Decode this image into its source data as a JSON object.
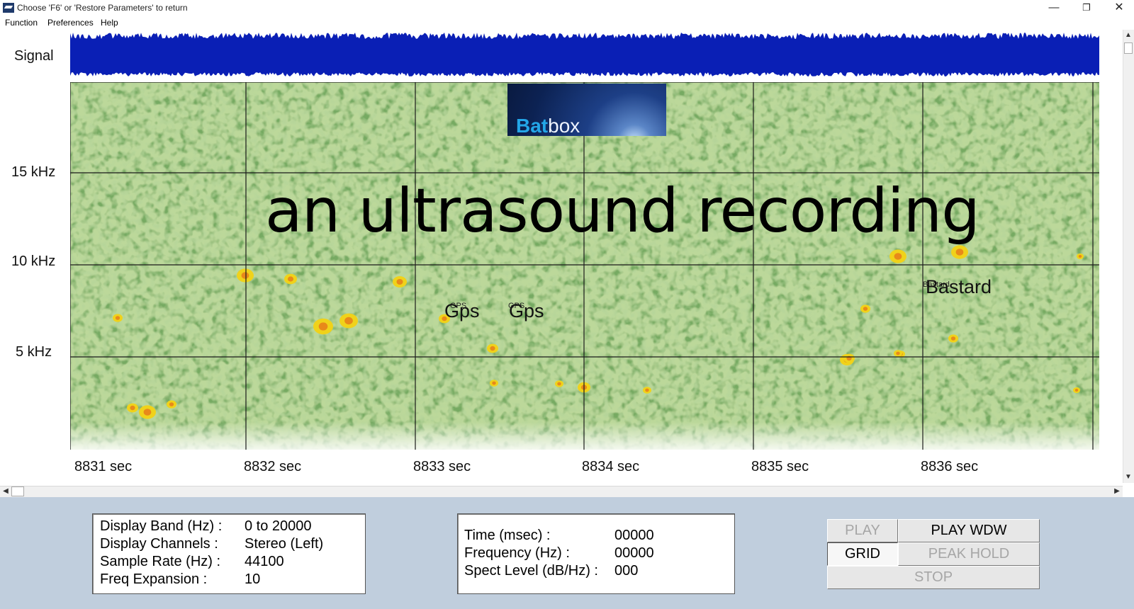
{
  "window": {
    "title": "Choose 'F6' or 'Restore Parameters' to return",
    "min_glyph": "—",
    "max_glyph": "❐",
    "close_glyph": "✕"
  },
  "menu": [
    "Function",
    "Preferences",
    "Help"
  ],
  "display": {
    "signal_label": "Signal",
    "freq_labels": [
      "15 kHz",
      "10 kHz",
      "5 kHz"
    ],
    "time_labels": [
      "8831 sec",
      "8832 sec",
      "8833 sec",
      "8834 sec",
      "8835 sec",
      "8836 sec"
    ],
    "logo": {
      "bold": "Bat",
      "rest": "box"
    },
    "overlay_title": "an ultrasound recording",
    "annotations": [
      {
        "small": "GPS",
        "large": "Gps"
      },
      {
        "small": "GPS",
        "large": "Gps"
      },
      {
        "small": "Bastard",
        "large": "Bastard"
      }
    ],
    "colors": {
      "waveform": "#0a1fb5",
      "spectrogram_background": "#bcd89a",
      "grid": "#1a1a1a"
    }
  },
  "scrollbars": {
    "up": "▲",
    "down": "▼",
    "left": "◀",
    "right": "▶"
  },
  "info_left": [
    {
      "label": "Display Band (Hz) :",
      "value": "0 to 20000"
    },
    {
      "label": "Display Channels  :",
      "value": "Stereo (Left)"
    },
    {
      "label": "Sample Rate (Hz) :",
      "value": "44100"
    },
    {
      "label": "Freq Expansion    :",
      "value": "10"
    }
  ],
  "info_right": [
    {
      "label": "Time (msec) :",
      "value": "00000"
    },
    {
      "label": "Frequency (Hz) :",
      "value": "00000"
    },
    {
      "label": "Spect Level (dB/Hz) :",
      "value": "000"
    }
  ],
  "buttons": {
    "play": "PLAY",
    "play_wdw": "PLAY WDW",
    "grid": "GRID",
    "peak_hold": "PEAK HOLD",
    "stop": "STOP"
  }
}
